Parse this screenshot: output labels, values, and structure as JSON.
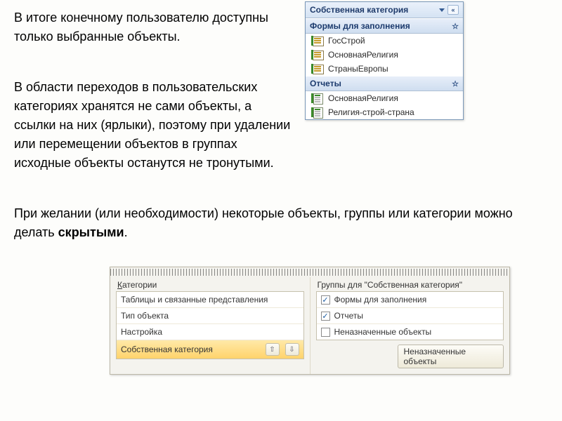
{
  "paragraphs": {
    "p1": "В итоге конечному пользователю доступны только выбранные объекты.",
    "p2": "В области переходов в пользовательских категориях хранятся не сами объекты, а ссылки на них (ярлыки), поэтому при удалении или перемещении объектов в группах исходные объекты останутся не тронутыми.",
    "p3_a": "При желании (или необходимости) некоторые объекты, группы или категории можно делать ",
    "p3_b": "скрытыми",
    "p3_c": "."
  },
  "nav": {
    "title": "Собственная категория",
    "groups": [
      {
        "label": "Формы для заполнения",
        "items": [
          {
            "icon": "form",
            "label": "ГосСтрой"
          },
          {
            "icon": "form",
            "label": "ОсновнаяРелигия"
          },
          {
            "icon": "form",
            "label": "СтраныЕвропы"
          }
        ]
      },
      {
        "label": "Отчеты",
        "items": [
          {
            "icon": "report",
            "label": "ОсновнаяРелигия"
          },
          {
            "icon": "report",
            "label": "Религия-строй-страна"
          }
        ]
      }
    ]
  },
  "dialog": {
    "left_label_u": "К",
    "left_label_rest": "атегории",
    "right_label_prefix": "Группы для \"",
    "right_label_category": "Собственная категория",
    "right_label_suffix": "\"",
    "categories": [
      {
        "label": "Таблицы и связанные представления",
        "selected": false
      },
      {
        "label": "Тип объекта",
        "selected": false
      },
      {
        "label": "Настройка",
        "selected": false
      },
      {
        "label": "Собственная категория",
        "selected": true
      }
    ],
    "arrow_up": "⇧",
    "arrow_down": "⇩",
    "groups": [
      {
        "checked": true,
        "label": "Формы для заполнения"
      },
      {
        "checked": true,
        "label": "Отчеты"
      },
      {
        "checked": false,
        "label": "Неназначенные объекты"
      }
    ],
    "button": "Неназначенные объекты"
  }
}
